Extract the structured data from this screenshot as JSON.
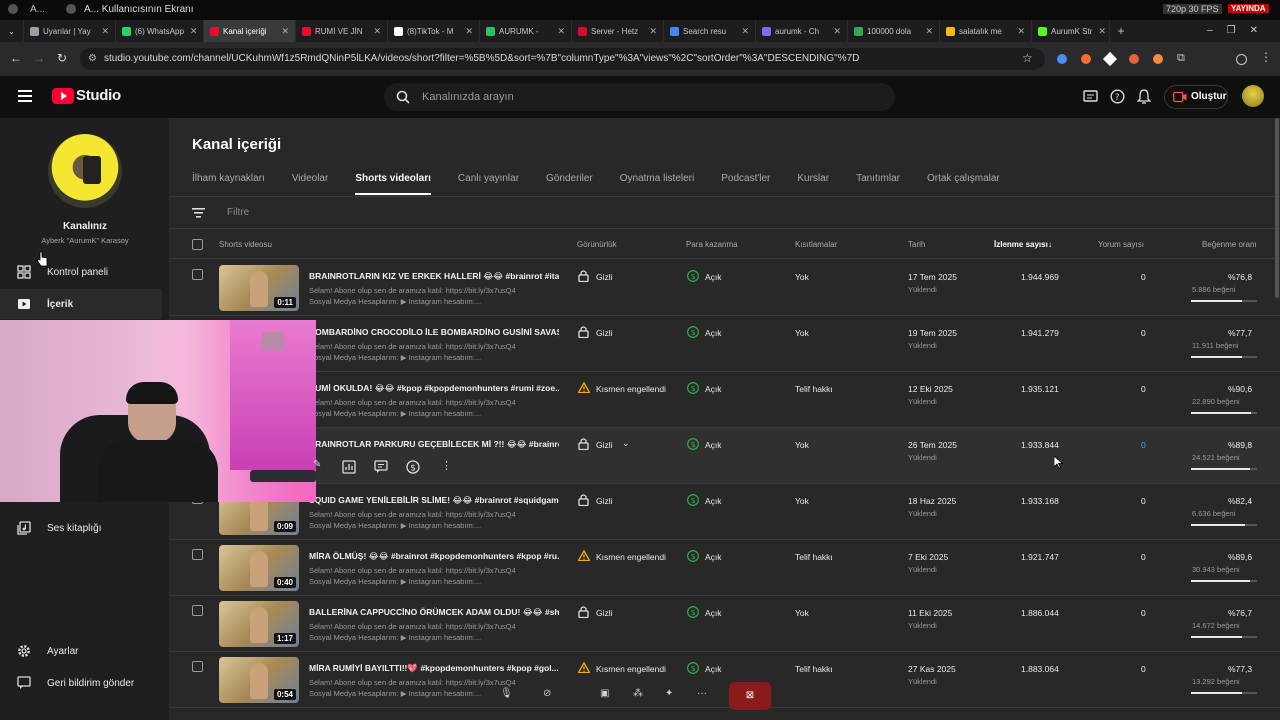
{
  "stream": {
    "title_left": "A...",
    "window_title": "A... Kullanıcısının Ekranı",
    "quality": "720p 30 FPS",
    "live_badge": "YAYINDA",
    "live_color": "#cc0000"
  },
  "browser": {
    "tabs": [
      {
        "label": "Uyarılar | Yay",
        "icon": "bell-icon",
        "color": "#9aa0a6"
      },
      {
        "label": "(6) WhatsApp",
        "icon": "whatsapp-icon",
        "color": "#25d366"
      },
      {
        "label": "Kanal içeriği",
        "icon": "studio-icon",
        "color": "#ff0033",
        "active": true
      },
      {
        "label": "RUMİ VE JİN",
        "icon": "youtube-icon",
        "color": "#ff0033"
      },
      {
        "label": "(8)TikTok - M",
        "icon": "tiktok-icon",
        "color": "#ffffff"
      },
      {
        "label": "AURUMK -",
        "icon": "a-icon",
        "color": "#22c55e"
      },
      {
        "label": "Server - Hetz",
        "icon": "hetzner-icon",
        "color": "#d50c2d"
      },
      {
        "label": "Search resu",
        "icon": "google-icon",
        "color": "#4285f4"
      },
      {
        "label": "aurumk - Ch",
        "icon": "chat-icon",
        "color": "#7c6cf2"
      },
      {
        "label": "100000 dola",
        "icon": "google-icon",
        "color": "#34a853"
      },
      {
        "label": "salatalık me",
        "icon": "google-icon",
        "color": "#fbbc05"
      },
      {
        "label": "AurumK Str",
        "icon": "kick-icon",
        "color": "#53fc18"
      }
    ],
    "url": "studio.youtube.com/channel/UCKuhmWf1z5RmdQNinP5lLKA/videos/short?filter=%5B%5D&sort=%7B\"columnType\"%3A\"views\"%2C\"sortOrder\"%3A\"DESCENDING\"%7D"
  },
  "header": {
    "logo_text": "Studio",
    "search_placeholder": "Kanalınızda arayın",
    "create_label": "Oluştur"
  },
  "sidebar": {
    "channel_title": "Kanalınız",
    "channel_name": "Ayberk \"AurumK\" Karasoy",
    "items": [
      {
        "label": "Kontrol paneli",
        "icon": "dashboard-icon"
      },
      {
        "label": "İçerik",
        "icon": "content-icon",
        "active": true
      },
      {
        "label": "Ses kitaplığı",
        "icon": "audio-library-icon"
      },
      {
        "label": "Ayarlar",
        "icon": "gear-icon"
      },
      {
        "label": "Geri bildirim gönder",
        "icon": "feedback-icon"
      }
    ]
  },
  "main": {
    "title": "Kanal içeriği",
    "tabs": [
      "İlham kaynakları",
      "Videolar",
      "Shorts videoları",
      "Canlı yayınlar",
      "Gönderiler",
      "Oynatma listeleri",
      "Podcast'ler",
      "Kurslar",
      "Tanıtımlar",
      "Ortak çalışmalar"
    ],
    "active_tab": 2,
    "filter_placeholder": "Filtre",
    "columns": {
      "video": "Shorts videosu",
      "visibility": "Görünürlük",
      "monetization": "Para kazanma",
      "restrictions": "Kısıtlamalar",
      "date": "Tarih",
      "views": "İzlenme sayısı",
      "comments": "Yorum sayısı",
      "likes": "Beğenme oranı"
    },
    "rows": [
      {
        "title": "BRAINROTLARIN KIZ VE ERKEK HALLERİ 😂😂 #brainrot #ita...",
        "desc1": "Selam! Abone olup sen de aramıza katıl: https://bit.ly/3x7usQ4",
        "desc2": "Sosyal Medya Hesaplarım: ▶ Instagram hesabım:...",
        "duration": "0:11",
        "visibility": "Gizli",
        "vis_icon": "lock-icon",
        "monetization": "Açık",
        "restriction": "Yok",
        "date": "17 Tem 2025",
        "date_sub": "Yüklendi",
        "views": "1.944.969",
        "comments": "0",
        "like_pct": "%76,8",
        "likes": "5.886 beğeni",
        "like_ratio": 0.768
      },
      {
        "title": "BOMBARDİNO CROCODİLO İLE BOMBARDİNO GUSİNİ SAVAŞ...",
        "desc1": "Selam! Abone olup sen de aramıza katıl: https://bit.ly/3x7usQ4",
        "desc2": "Sosyal Medya Hesaplarım: ▶ Instagram hesabım:...",
        "duration": "",
        "visibility": "Gizli",
        "vis_icon": "lock-icon",
        "monetization": "Açık",
        "restriction": "Yok",
        "date": "19 Tem 2025",
        "date_sub": "Yüklendi",
        "views": "1.941.279",
        "comments": "0",
        "like_pct": "%77,7",
        "likes": "11.911 beğeni",
        "like_ratio": 0.777
      },
      {
        "title": "RUMİ OKULDA! 😂😂 #kpop #kpopdemonhunters #rumi #zoe...",
        "desc1": "Selam! Abone olup sen de aramıza katıl: https://bit.ly/3x7usQ4",
        "desc2": "Sosyal Medya Hesaplarım: ▶ Instagram hesabım:...",
        "duration": "",
        "visibility": "Kısmen engellendi",
        "vis_icon": "warning-icon",
        "monetization": "Açık",
        "restriction": "Telif hakkı",
        "date": "12 Eki 2025",
        "date_sub": "Yüklendi",
        "views": "1.935.121",
        "comments": "0",
        "like_pct": "%90,6",
        "likes": "22.890 beğeni",
        "like_ratio": 0.906
      },
      {
        "title": "BRAINROTLAR PARKURU GEÇEBİLECEK Mİ ?!! 😂😂 #brainrot...",
        "desc1": "",
        "desc2": "",
        "duration": "",
        "visibility": "Gizli",
        "vis_icon": "lock-icon",
        "monetization": "Açık",
        "restriction": "Yok",
        "date": "26 Tem 2025",
        "date_sub": "Yüklendi",
        "views": "1.933.844",
        "comments": "0",
        "like_pct": "%89,8",
        "likes": "24.521 beğeni",
        "like_ratio": 0.898,
        "hover": true
      },
      {
        "title": "SQUID GAME YENİLEBİLİR SLİME! 😂😂 #brainrot #squidgam...",
        "desc1": "Selam! Abone olup sen de aramıza katıl: https://bit.ly/3x7usQ4",
        "desc2": "Sosyal Medya Hesaplarım: ▶ Instagram hesabım:...",
        "duration": "0:09",
        "visibility": "Gizli",
        "vis_icon": "lock-icon",
        "monetization": "Açık",
        "restriction": "Yok",
        "date": "18 Haz 2025",
        "date_sub": "Yüklendi",
        "views": "1.933.168",
        "comments": "0",
        "like_pct": "%82,4",
        "likes": "6.636 beğeni",
        "like_ratio": 0.824
      },
      {
        "title": "MİRA ÖLMÜŞ! 😂😂 #brainrot #kpopdemonhunters #kpop #ru...",
        "desc1": "Selam! Abone olup sen de aramıza katıl: https://bit.ly/3x7usQ4",
        "desc2": "Sosyal Medya Hesaplarım: ▶ Instagram hesabım:...",
        "duration": "0:40",
        "visibility": "Kısmen engellendi",
        "vis_icon": "warning-icon",
        "monetization": "Açık",
        "restriction": "Telif hakkı",
        "date": "7 Eki 2025",
        "date_sub": "Yüklendi",
        "views": "1.921.747",
        "comments": "0",
        "like_pct": "%89,6",
        "likes": "30.943 beğeni",
        "like_ratio": 0.896
      },
      {
        "title": "BALLERİNA CAPPUCCİNO ÖRÜMCEK ADAM OLDU! 😂😂 #sh...",
        "desc1": "Selam! Abone olup sen de aramıza katıl: https://bit.ly/3x7usQ4",
        "desc2": "Sosyal Medya Hesaplarım: ▶ Instagram hesabım:...",
        "duration": "1:17",
        "visibility": "Gizli",
        "vis_icon": "lock-icon",
        "monetization": "Açık",
        "restriction": "Yok",
        "date": "11 Eki 2025",
        "date_sub": "Yüklendi",
        "views": "1.886.044",
        "comments": "0",
        "like_pct": "%76,7",
        "likes": "14.672 beğeni",
        "like_ratio": 0.767
      },
      {
        "title": "MİRA RUMİYİ BAYILTTI!!💖 #kpopdemonhunters #kpop #gol...",
        "desc1": "Selam! Abone olup sen de aramıza katıl: https://bit.ly/3x7usQ4",
        "desc2": "Sosyal Medya Hesaplarım: ▶ Instagram hesabım:...",
        "duration": "0:54",
        "visibility": "Kısmen engellendi",
        "vis_icon": "warning-icon",
        "monetization": "Açık",
        "restriction": "Telif hakkı",
        "date": "27 Kas 2025",
        "date_sub": "Yüklendi",
        "views": "1.883.064",
        "comments": "0",
        "like_pct": "%77,3",
        "likes": "13.292 beğeni",
        "like_ratio": 0.773
      }
    ]
  },
  "colors": {
    "accent_red": "#ff0033",
    "monetization_green": "#2ba640",
    "warning_yellow": "#f9ab00",
    "link_blue": "#3ea6ff"
  }
}
